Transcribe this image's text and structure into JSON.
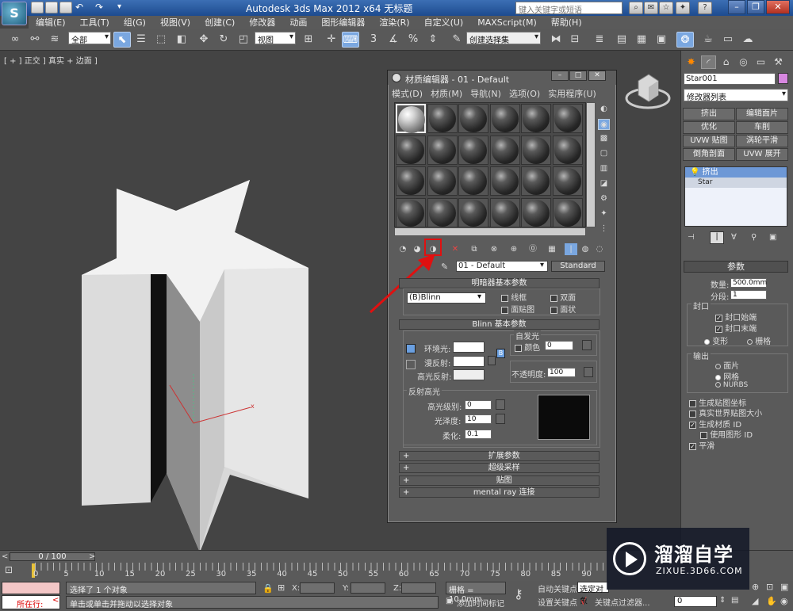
{
  "app": {
    "logo_letter": "S",
    "title": "Autodesk 3ds Max  2012 x64       无标题",
    "search_placeholder": "键入关键字或短语"
  },
  "menubar": [
    "编辑(E)",
    "工具(T)",
    "组(G)",
    "视图(V)",
    "创建(C)",
    "修改器",
    "动画",
    "图形编辑器",
    "渲染(R)",
    "自定义(U)",
    "MAXScript(M)",
    "帮助(H)"
  ],
  "main_toolbar": {
    "selection_filter": "全部",
    "reference_coord": "视图",
    "named_selection": "创建选择集"
  },
  "viewport": {
    "label": "[ + ] 正交 ] 真实 + 边面 ]"
  },
  "command_panel": {
    "object_name": "Star001",
    "modifier_list": "修改器列表",
    "buttons": [
      "挤出",
      "编辑面片",
      "优化",
      "车削",
      "UVW 贴图",
      "涡轮平滑",
      "倒角剖面",
      "UVW 展开"
    ],
    "stack": [
      "挤出",
      "Star"
    ],
    "params_title": "参数",
    "amount_label": "数量:",
    "amount_value": "500.0mm",
    "segments_label": "分段:",
    "segments_value": "1",
    "cap_group": "封口",
    "cap_start": "封口始端",
    "cap_end": "封口末端",
    "morph": "变形",
    "grid": "栅格",
    "output_group": "输出",
    "out_patch": "面片",
    "out_mesh": "网格",
    "out_nurbs": "NURBS",
    "gen_map_coords": "生成贴图坐标",
    "real_world": "真实世界贴图大小",
    "gen_mat_ids": "生成材质 ID",
    "use_shape_ids": "使用图形 ID",
    "smooth": "平滑"
  },
  "material_editor": {
    "title": "材质编辑器 - 01 - Default",
    "menu": [
      "模式(D)",
      "材质(M)",
      "导航(N)",
      "选项(O)",
      "实用程序(U)"
    ],
    "material_name": "01 - Default",
    "material_type": "Standard",
    "shader_rollout": "明暗器基本参数",
    "shader_value": "(B)Blinn",
    "wire": "线框",
    "two_sided": "双面",
    "face_map": "面贴图",
    "faceted": "面状",
    "blinn_rollout": "Blinn 基本参数",
    "self_illum": "自发光",
    "color_label": "颜色",
    "color_value": "0",
    "ambient": "环境光:",
    "diffuse": "漫反射:",
    "specular": "高光反射:",
    "opacity_label": "不透明度:",
    "opacity_value": "100",
    "spec_group": "反射高光",
    "spec_level_label": "高光级别:",
    "spec_level_value": "0",
    "gloss_label": "光泽度:",
    "gloss_value": "10",
    "soften_label": "柔化:",
    "soften_value": "0.1",
    "collapsed_rollouts": [
      "扩展参数",
      "超级采样",
      "贴图",
      "mental ray 连接"
    ]
  },
  "timeline": {
    "frame": "0 / 100",
    "ticks": [
      "0",
      "5",
      "10",
      "15",
      "20",
      "25",
      "30",
      "35",
      "40",
      "45",
      "50",
      "55",
      "60",
      "65",
      "70",
      "75",
      "80",
      "85",
      "90"
    ]
  },
  "status": {
    "running": "所在行:",
    "selected": "选择了 1 个对象",
    "prompt": "单击或单击并拖动以选择对象",
    "x_label": "X:",
    "y_label": "Y:",
    "z_label": "Z:",
    "grid": "栅格 = 10.0mm",
    "add_time_tag": "添加时间标记",
    "auto_key": "自动关键点",
    "selected_obj": "选定对象",
    "set_key": "设置关键点",
    "key_filters": "关键点过滤器...",
    "frame_value": "0"
  },
  "watermark": {
    "brand": "溜溜自学",
    "url": "ZIXUE.3D66.COM"
  },
  "colors": {
    "highlight": "#e01010",
    "active_blue": "#7aa7e0"
  }
}
